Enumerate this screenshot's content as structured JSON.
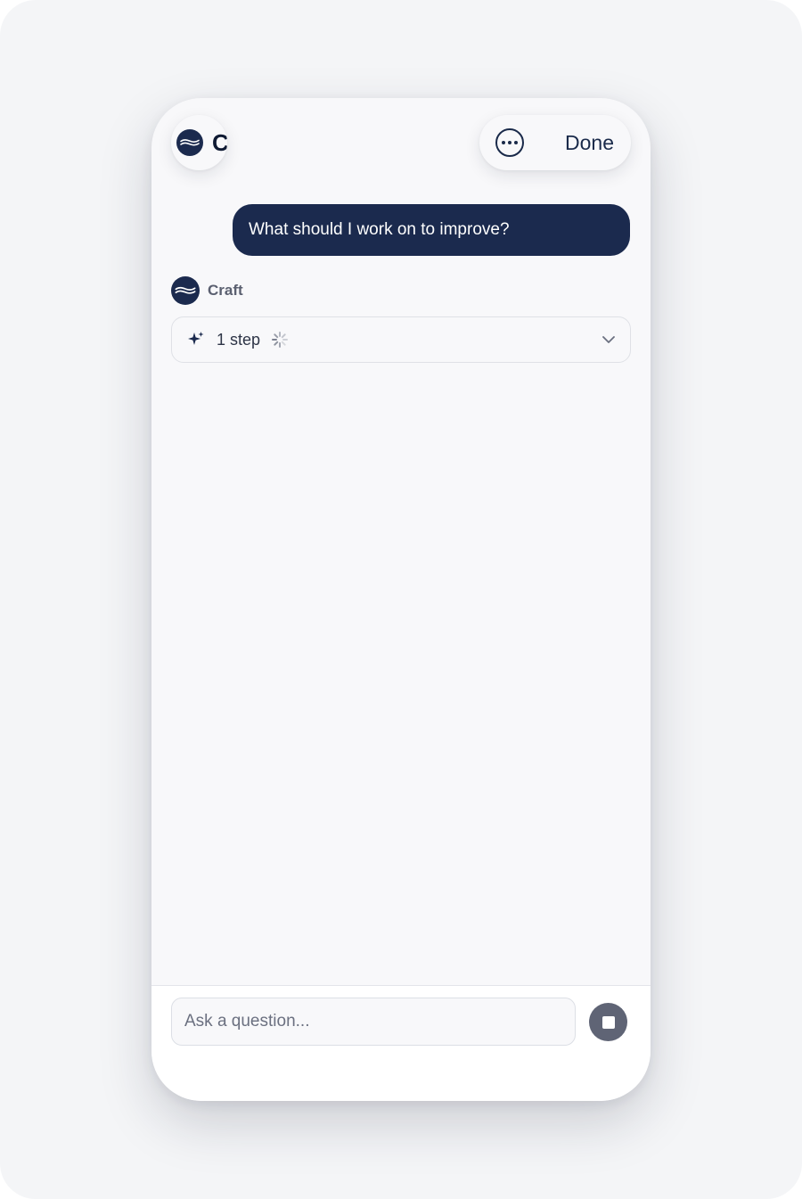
{
  "app": {
    "name": "Craft",
    "logo_icon": "craft-wave-logo-icon"
  },
  "header": {
    "more_icon": "more-horizontal-icon",
    "done_label": "Done"
  },
  "conversation": {
    "user_message": "What should I work on to improve?",
    "assistant": {
      "name": "Craft",
      "steps_label": "1 step",
      "sparkle_icon": "sparkle-icon",
      "spinner_icon": "loading-spinner-icon",
      "chevron_icon": "chevron-down-icon"
    }
  },
  "composer": {
    "placeholder": "Ask a question...",
    "stop_icon": "stop-icon"
  },
  "colors": {
    "brand_navy": "#1b2a4e",
    "background": "#f8f8fa",
    "stop_button": "#5f6475"
  }
}
